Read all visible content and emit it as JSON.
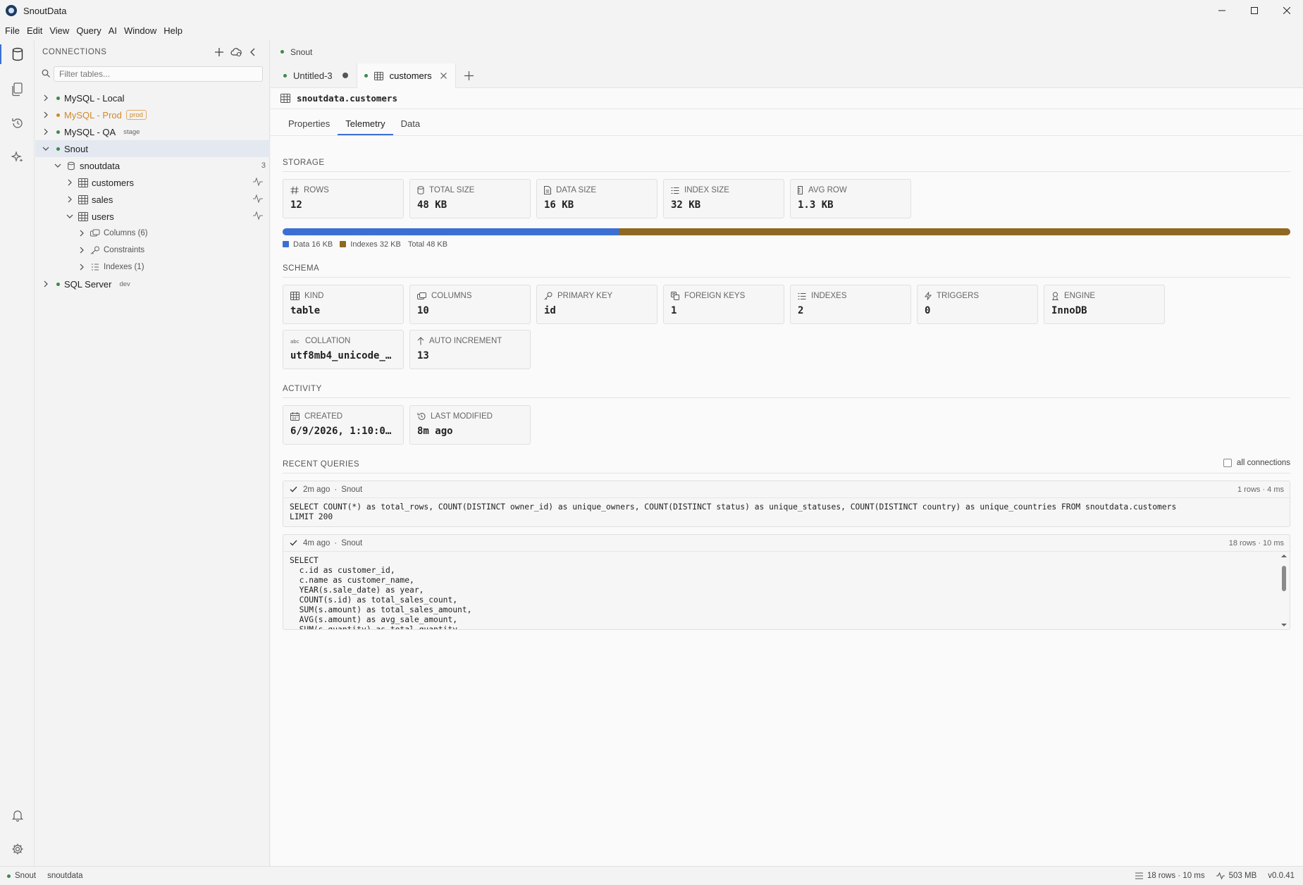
{
  "app": {
    "title": "SnoutData",
    "version": "v0.0.41"
  },
  "menu": [
    "File",
    "Edit",
    "View",
    "Query",
    "AI",
    "Window",
    "Help"
  ],
  "sidebar": {
    "title": "CONNECTIONS",
    "filter_placeholder": "Filter tables...",
    "connections": [
      {
        "name": "MySQL - Local",
        "badge": "",
        "dot_color": "#3c8a4a"
      },
      {
        "name": "MySQL - Prod",
        "badge": "prod",
        "dot_color": "#d0892b",
        "name_color": "#d0892b"
      },
      {
        "name": "MySQL - QA",
        "badge": "stage",
        "dot_color": "#3c8a4a"
      },
      {
        "name": "Snout",
        "badge": "",
        "dot_color": "#3c8a4a"
      },
      {
        "name": "SQL Server",
        "badge": "dev",
        "dot_color": "#3c8a4a"
      }
    ],
    "database": {
      "name": "snoutdata",
      "count": "3"
    },
    "tables": [
      "customers",
      "sales",
      "users"
    ],
    "users_children": [
      "Columns (6)",
      "Constraints",
      "Indexes (1)"
    ]
  },
  "main": {
    "connection": "Snout",
    "tabs": [
      {
        "label": "Untitled-3"
      },
      {
        "label": "customers"
      }
    ],
    "object_title": "snoutdata.customers",
    "subtabs": [
      "Properties",
      "Telemetry",
      "Data"
    ],
    "storage": {
      "section": "STORAGE",
      "cards": [
        {
          "label": "ROWS",
          "value": "12",
          "icon": "hash-icon"
        },
        {
          "label": "TOTAL SIZE",
          "value": "48 KB",
          "icon": "cylinder-icon"
        },
        {
          "label": "DATA SIZE",
          "value": "16 KB",
          "icon": "file-icon"
        },
        {
          "label": "INDEX SIZE",
          "value": "32 KB",
          "icon": "list-icon"
        },
        {
          "label": "AVG ROW",
          "value": "1.3 KB",
          "icon": "ruler-icon"
        }
      ],
      "data_fraction": 0.3333,
      "legend": {
        "data": "Data 16 KB",
        "indexes": "Indexes 32 KB",
        "total": "Total 48 KB"
      },
      "colors": {
        "data": "#3b6fd4",
        "indexes": "#8e6720"
      }
    },
    "schema": {
      "section": "SCHEMA",
      "cards": [
        {
          "label": "KIND",
          "value": "table",
          "icon": "grid-icon"
        },
        {
          "label": "COLUMNS",
          "value": "10",
          "icon": "columns-icon"
        },
        {
          "label": "PRIMARY KEY",
          "value": "id",
          "icon": "key-icon"
        },
        {
          "label": "FOREIGN KEYS",
          "value": "1",
          "icon": "link-icon"
        },
        {
          "label": "INDEXES",
          "value": "2",
          "icon": "list-icon"
        },
        {
          "label": "TRIGGERS",
          "value": "0",
          "icon": "bolt-icon"
        },
        {
          "label": "ENGINE",
          "value": "InnoDB",
          "icon": "engine-icon"
        },
        {
          "label": "COLLATION",
          "value": "utf8mb4_unicode_…",
          "icon": "abc-icon"
        },
        {
          "label": "AUTO INCREMENT",
          "value": "13",
          "icon": "arrow-up-icon"
        }
      ]
    },
    "activity": {
      "section": "ACTIVITY",
      "cards": [
        {
          "label": "CREATED",
          "value": "6/9/2026, 1:10:0…",
          "icon": "calendar-icon"
        },
        {
          "label": "LAST MODIFIED",
          "value": "8m ago",
          "icon": "history-icon"
        }
      ]
    },
    "recent": {
      "section": "RECENT QUERIES",
      "all_connections_label": "all connections",
      "queries": [
        {
          "when": "2m ago",
          "conn": "Snout",
          "meta": "1 rows · 4 ms",
          "sql": "SELECT COUNT(*) as total_rows, COUNT(DISTINCT owner_id) as unique_owners, COUNT(DISTINCT status) as unique_statuses, COUNT(DISTINCT country) as unique_countries FROM snoutdata.customers\nLIMIT 200"
        },
        {
          "when": "4m ago",
          "conn": "Snout",
          "meta": "18 rows · 10 ms",
          "sql": "SELECT\n  c.id as customer_id,\n  c.name as customer_name,\n  YEAR(s.sale_date) as year,\n  COUNT(s.id) as total_sales_count,\n  SUM(s.amount) as total_sales_amount,\n  AVG(s.amount) as avg_sale_amount,\n  SUM(s.quantity) as total_quantity,"
        }
      ]
    }
  },
  "status": {
    "connection": "Snout",
    "database": "snoutdata",
    "rows": "18 rows · 10 ms",
    "memory": "503 MB",
    "version": "v0.0.41"
  }
}
